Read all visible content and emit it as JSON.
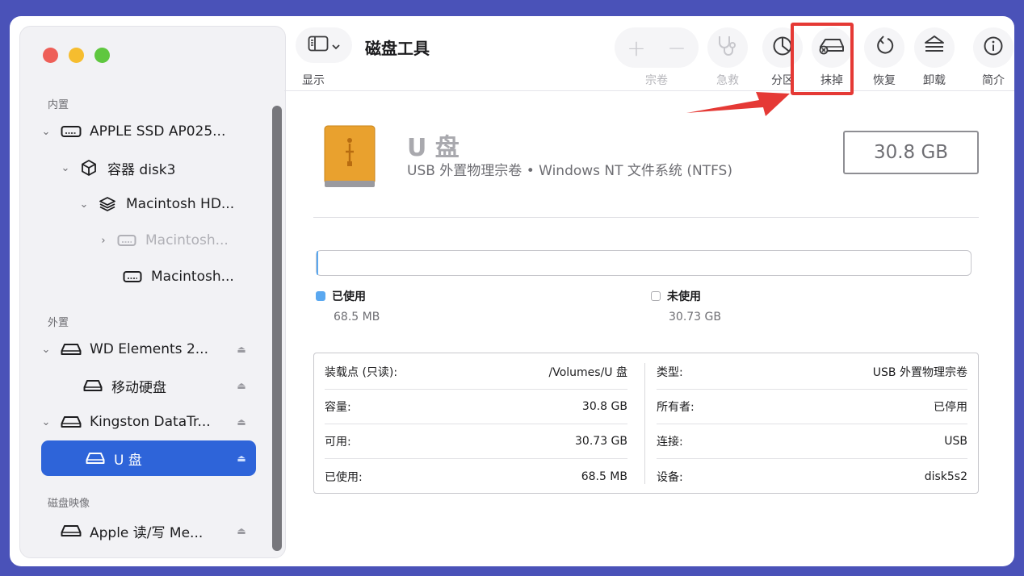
{
  "sidebar": {
    "sections": {
      "internal": "内置",
      "external": "外置",
      "disk_images": "磁盘映像"
    },
    "items": [
      {
        "label": "APPLE SSD AP025...",
        "chevron": "down",
        "icon": "hard-drive-icon"
      },
      {
        "label": "容器 disk3",
        "chevron": "down",
        "icon": "container-cube-icon"
      },
      {
        "label": "Macintosh HD...",
        "chevron": "down",
        "icon": "layers-icon"
      },
      {
        "label": "Macintosh...",
        "chevron": "right",
        "icon": "hard-drive-icon"
      },
      {
        "label": "Macintosh...",
        "chevron": "",
        "icon": "hard-drive-icon"
      },
      {
        "label": "WD Elements 2...",
        "chevron": "down",
        "icon": "external-drive-icon"
      },
      {
        "label": "移动硬盘",
        "chevron": "",
        "icon": "external-drive-icon"
      },
      {
        "label": "Kingston DataTr...",
        "chevron": "down",
        "icon": "external-drive-icon"
      },
      {
        "label": "U 盘",
        "chevron": "",
        "icon": "external-drive-icon"
      },
      {
        "label": "Apple 读/写 Me...",
        "chevron": "",
        "icon": "external-drive-icon"
      }
    ],
    "eject_glyph": "⏏"
  },
  "toolbar": {
    "title": "磁盘工具",
    "view_label": "显示",
    "volume_label": "宗卷",
    "first_aid_label": "急救",
    "partition_label": "分区",
    "erase_label": "抹掉",
    "restore_label": "恢复",
    "unmount_label": "卸载",
    "info_label": "简介",
    "plus_glyph": "+",
    "minus_glyph": "−"
  },
  "volume": {
    "name": "U 盘",
    "description": "USB 外置物理宗卷 • Windows NT 文件系统 (NTFS)",
    "capacity": "30.8 GB"
  },
  "usage": {
    "used_fraction": 0.0022,
    "used_label": "已使用",
    "used_value": "68.5 MB",
    "used_color": "#5aa8f0",
    "free_label": "未使用",
    "free_value": "30.73 GB"
  },
  "info_left": [
    {
      "key": "装载点 (只读):",
      "value": "/Volumes/U 盘"
    },
    {
      "key": "容量:",
      "value": "30.8 GB"
    },
    {
      "key": "可用:",
      "value": "30.73 GB"
    },
    {
      "key": "已使用:",
      "value": "68.5 MB"
    }
  ],
  "info_right": [
    {
      "key": "类型:",
      "value": "USB 外置物理宗卷"
    },
    {
      "key": "所有者:",
      "value": "已停用"
    },
    {
      "key": "连接:",
      "value": "USB"
    },
    {
      "key": "设备:",
      "value": "disk5s2"
    }
  ],
  "colors": {
    "accent": "#2e64d9",
    "highlight": "#e53935",
    "drive_orange": "#e9a12e"
  }
}
